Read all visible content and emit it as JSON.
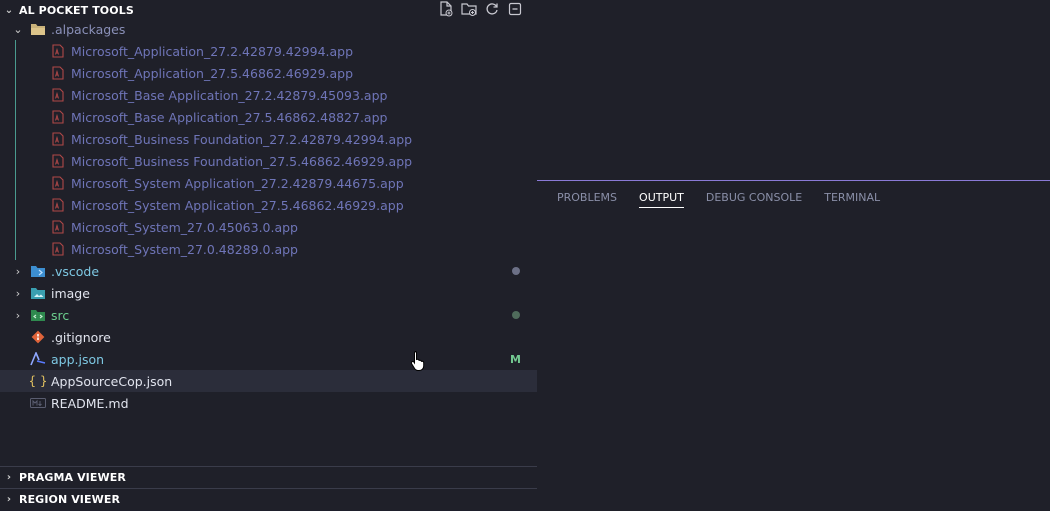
{
  "sidebar": {
    "title": "AL POCKET TOOLS",
    "tree": {
      "alpackages": {
        "label": ".alpackages",
        "items": [
          "Microsoft_Application_27.2.42879.42994.app",
          "Microsoft_Application_27.5.46862.46929.app",
          "Microsoft_Base Application_27.2.42879.45093.app",
          "Microsoft_Base Application_27.5.46862.48827.app",
          "Microsoft_Business Foundation_27.2.42879.42994.app",
          "Microsoft_Business Foundation_27.5.46862.46929.app",
          "Microsoft_System Application_27.2.42879.44675.app",
          "Microsoft_System Application_27.5.46862.46929.app",
          "Microsoft_System_27.0.45063.0.app",
          "Microsoft_System_27.0.48289.0.app"
        ]
      },
      "vscode": {
        "label": ".vscode"
      },
      "image": {
        "label": "image"
      },
      "src": {
        "label": "src"
      },
      "gitignore": {
        "label": ".gitignore"
      },
      "appjson": {
        "label": "app.json",
        "badge": "M"
      },
      "appsourcecop": {
        "label": "AppSourceCop.json"
      },
      "readme": {
        "label": "README.md"
      }
    },
    "sections": {
      "pragma": "PRAGMA VIEWER",
      "region": "REGION VIEWER"
    }
  },
  "panel": {
    "tabs": [
      "PROBLEMS",
      "OUTPUT",
      "DEBUG CONSOLE",
      "TERMINAL"
    ],
    "active_tab": "OUTPUT"
  },
  "colors": {
    "accent": "#8a7ad6",
    "folder_label": "#7ec8e3",
    "src_label": "#6ccf8e",
    "app_label": "#6f75b8",
    "modified_badge": "#73c991"
  }
}
